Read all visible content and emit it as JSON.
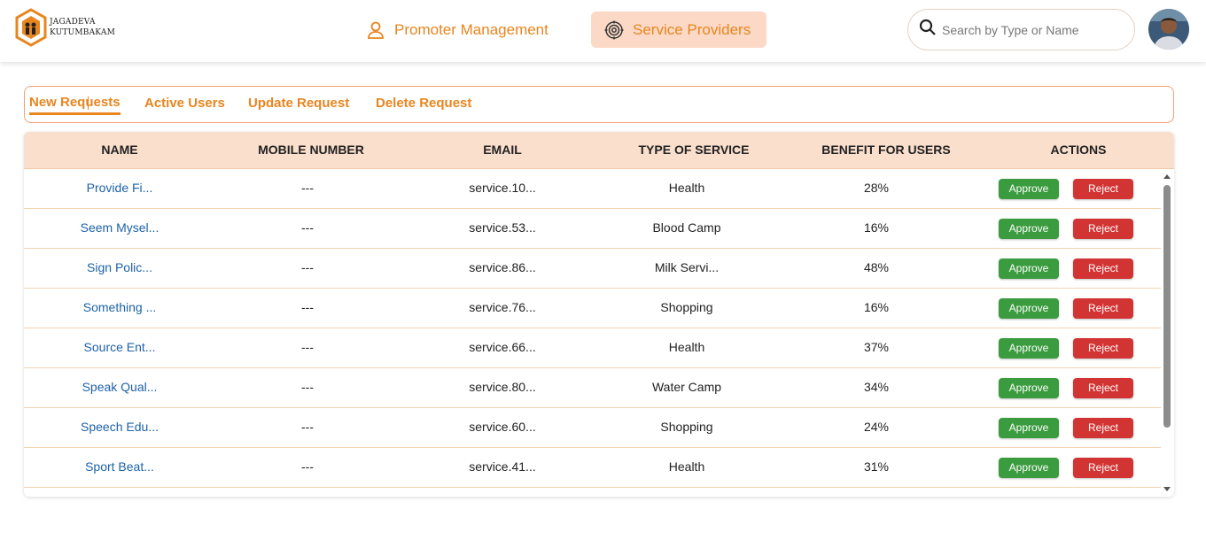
{
  "brand": {
    "line1": "JAGADEVA",
    "line2": "KUTUMBAKAM"
  },
  "nav": {
    "promoter_label": "Promoter Management",
    "service_label": "Service Providers"
  },
  "search": {
    "placeholder": "Search by Type or Name"
  },
  "tabs": [
    {
      "label": "New Requests",
      "active": true
    },
    {
      "label": "Active Users",
      "active": false
    },
    {
      "label": "Update Request",
      "active": false
    },
    {
      "label": "Delete Request",
      "active": false
    }
  ],
  "table": {
    "columns": [
      "NAME",
      "MOBILE NUMBER",
      "EMAIL",
      "TYPE OF SERVICE",
      "BENEFIT FOR USERS",
      "ACTIONS"
    ],
    "approve_label": "Approve",
    "reject_label": "Reject",
    "rows": [
      {
        "name": "Provide Fi...",
        "mobile": "---",
        "email": "service.10...",
        "type": "Health",
        "benefit": "28%"
      },
      {
        "name": "Seem Mysel...",
        "mobile": "---",
        "email": "service.53...",
        "type": "Blood Camp",
        "benefit": "16%"
      },
      {
        "name": "Sign Polic...",
        "mobile": "---",
        "email": "service.86...",
        "type": "Milk Servi...",
        "benefit": "48%"
      },
      {
        "name": "Something ...",
        "mobile": "---",
        "email": "service.76...",
        "type": "Shopping",
        "benefit": "16%"
      },
      {
        "name": "Source Ent...",
        "mobile": "---",
        "email": "service.66...",
        "type": "Health",
        "benefit": "37%"
      },
      {
        "name": "Speak Qual...",
        "mobile": "---",
        "email": "service.80...",
        "type": "Water Camp",
        "benefit": "34%"
      },
      {
        "name": "Speech Edu...",
        "mobile": "---",
        "email": "service.60...",
        "type": "Shopping",
        "benefit": "24%"
      },
      {
        "name": "Sport Beat...",
        "mobile": "---",
        "email": "service.41...",
        "type": "Health",
        "benefit": "31%"
      }
    ]
  },
  "colors": {
    "accent": "#e8851f",
    "header_bg": "#fbdfcd",
    "approve": "#3b9b3f",
    "reject": "#d23434",
    "name_link": "#1e62a8"
  }
}
